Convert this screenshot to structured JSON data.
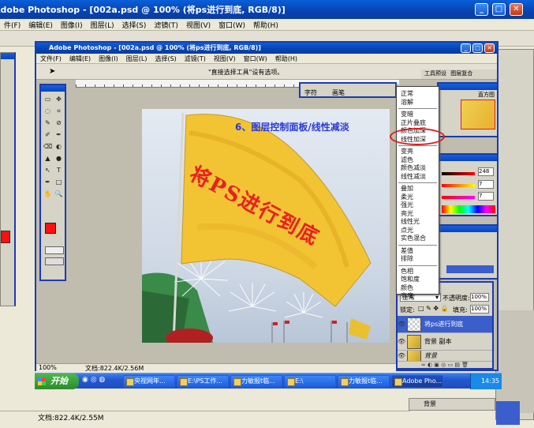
{
  "outer_window": {
    "title": "Adobe Photoshop - [002a.psd @ 100% (将ps进行到底, RGB/8)]",
    "menus": [
      "件(F)",
      "编辑(E)",
      "图像(I)",
      "图层(L)",
      "选择(S)",
      "滤镜(T)",
      "视图(V)",
      "窗口(W)",
      "帮助(H)"
    ],
    "status": "文档:822.4K/2.55M"
  },
  "inner_window": {
    "title": "Adobe Photoshop - [002a.psd @ 100% (将ps进行到底, RGB/8)]",
    "menus": [
      "文件(F)",
      "编辑(E)",
      "图像(I)",
      "图层(L)",
      "选择(S)",
      "滤镜(T)",
      "视图(V)",
      "窗口(W)",
      "帮助(H)"
    ],
    "options_hint": "\"直接选择工具\"设有选项。",
    "zoom": "100%",
    "status": "文档:822.4K/2.56M",
    "panel_tabs": [
      "字符",
      "画笔",
      "工具预设",
      "图层复合"
    ],
    "histogram_tab": "直方图",
    "color_values": [
      "248",
      "7",
      "7"
    ]
  },
  "canvas": {
    "caption": "6、图层控制面板/线性减淡",
    "flag_text": "将PS进行到底"
  },
  "blend_modes": {
    "groups": [
      [
        "正常",
        "溶解"
      ],
      [
        "变暗",
        "正片叠底",
        "颜色加深",
        "线性加深"
      ],
      [
        "变亮",
        "滤色",
        "颜色减淡",
        "线性减淡"
      ],
      [
        "叠加",
        "柔光",
        "强光",
        "亮光",
        "线性光",
        "点光",
        "实色混合"
      ],
      [
        "差值",
        "排除"
      ],
      [
        "色相",
        "饱和度",
        "颜色",
        "亮度"
      ]
    ],
    "highlighted": "线性加深"
  },
  "layers_panel": {
    "mode_value": "正常",
    "opacity_label": "不透明度:",
    "opacity_value": "100%",
    "lock_label": "锁定:",
    "fill_label": "填充:",
    "fill_value": "100%",
    "layers": [
      {
        "name": "将ps进行到底",
        "selected": true
      },
      {
        "name": "背景 副本",
        "selected": false
      },
      {
        "name": "背景",
        "selected": false
      }
    ]
  },
  "taskbar": {
    "start": "开始",
    "items": [
      "央视网年...",
      "E:\\PS工作...",
      "力敏报t临...",
      "E:\\",
      "力敏报t临...",
      "Adobe Pho..."
    ],
    "clock": "14:35"
  },
  "colors": {
    "title_blue": "#0a44b8",
    "foreground": "#ff1010",
    "highlight_circle": "#e01818",
    "flag": "#f2c434"
  }
}
